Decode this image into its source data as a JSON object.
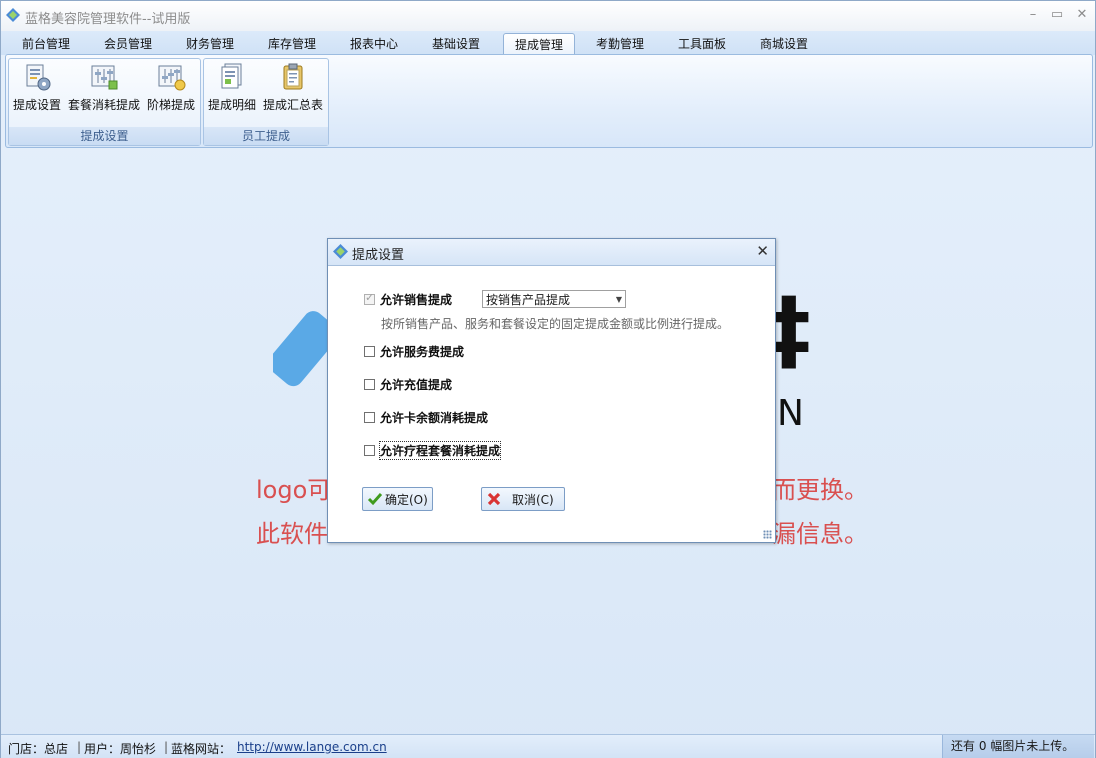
{
  "window": {
    "title": "蓝格美容院管理软件--试用版",
    "minimize": "–",
    "maximize": "▭",
    "close": "✕"
  },
  "tabs": [
    {
      "label": "前台管理"
    },
    {
      "label": "会员管理"
    },
    {
      "label": "财务管理"
    },
    {
      "label": "库存管理"
    },
    {
      "label": "报表中心"
    },
    {
      "label": "基础设置"
    },
    {
      "label": "提成管理",
      "active": true
    },
    {
      "label": "考勤管理"
    },
    {
      "label": "工具面板"
    },
    {
      "label": "商城设置"
    }
  ],
  "ribbon": {
    "groups": [
      {
        "label": "提成设置",
        "buttons": [
          "提成设置",
          "套餐消耗提成",
          "阶梯提成"
        ]
      },
      {
        "label": "员工提成",
        "buttons": [
          "提成明细",
          "提成汇总表"
        ]
      }
    ]
  },
  "background": {
    "glyph": "‡",
    "letter": "N",
    "line1_left": "logo可",
    "line1_right": "而更换。",
    "line2_left": "此软件",
    "line2_right": "漏信息。"
  },
  "dialog": {
    "title": "提成设置",
    "close": "✕",
    "options": [
      {
        "label": "允许销售提成",
        "checked": true,
        "disabled": true
      },
      {
        "label": "允许服务费提成",
        "checked": false
      },
      {
        "label": "允许充值提成",
        "checked": false
      },
      {
        "label": "允许卡余额消耗提成",
        "checked": false
      },
      {
        "label": "允许疗程套餐消耗提成",
        "checked": false
      }
    ],
    "sales_mode": {
      "selected": "按销售产品提成"
    },
    "hint": "按所销售产品、服务和套餐设定的固定提成金额或比例进行提成。",
    "ok_label": "确定(O)",
    "cancel_label": "取消(C)"
  },
  "statusbar": {
    "store_label": "门店：总店",
    "user_label": "用户：周怡杉",
    "site_label": "蓝格网站：",
    "site_url": "http://www.lange.com.cn",
    "upload_status": "还有 0 幅图片未上传。"
  }
}
